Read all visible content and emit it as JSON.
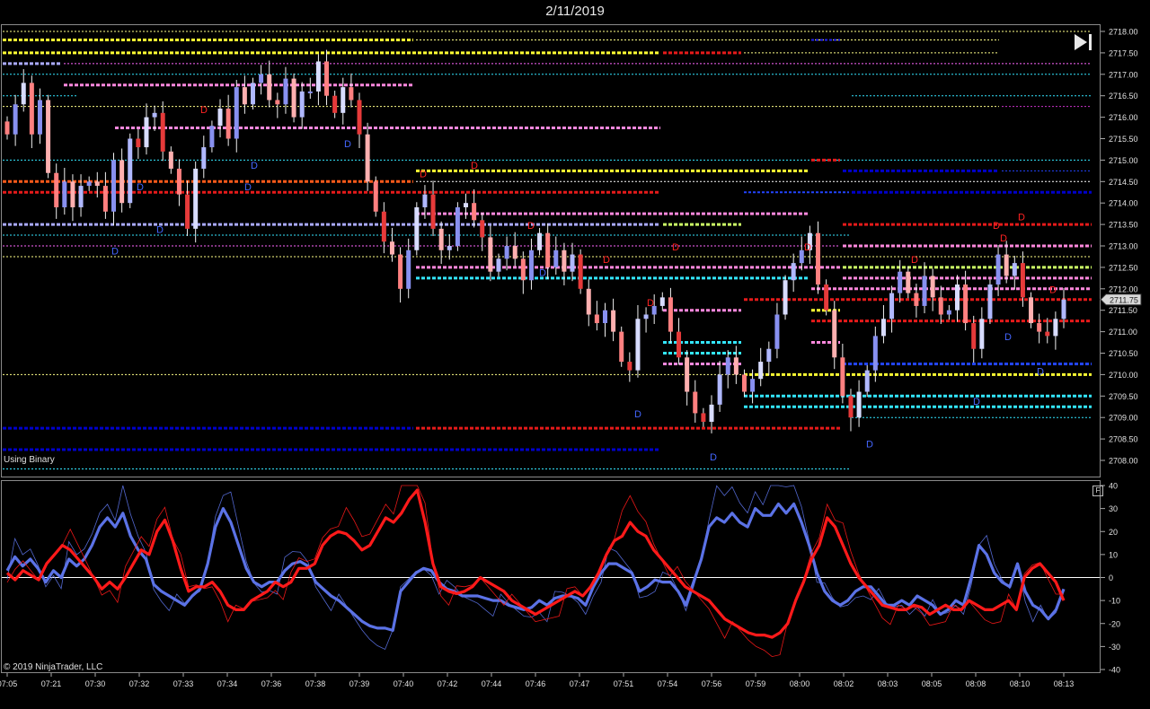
{
  "window": {
    "title": "2/11/2019"
  },
  "status_text": "Using Binary",
  "copyright": "© 2019 NinjaTrader, LLC",
  "buttons": {
    "skip_to_end": "skip-to-end-icon",
    "panel_f": "F"
  },
  "colors": {
    "up": "#b0b8ff",
    "down": "#ff8080",
    "blue_line": "#5b72e6",
    "red_line": "#ff1a1a",
    "yellow": "#ffff33",
    "pink": "#ff88dd",
    "cyan": "#33e6ff",
    "navy": "#0000cc",
    "red_level": "#e61a1a",
    "orange": "#ff5a1a"
  },
  "chart_data": [
    {
      "type": "candlestick",
      "title": "",
      "ylim": [
        2707.75,
        2718.1
      ],
      "y_ticks": [
        "2718.00",
        "2717.50",
        "2717.00",
        "2716.50",
        "2716.00",
        "2715.50",
        "2715.00",
        "2714.50",
        "2714.00",
        "2713.50",
        "2713.00",
        "2712.50",
        "2712.00",
        "2711.50",
        "2711.00",
        "2710.50",
        "2710.00",
        "2709.50",
        "2709.00",
        "2708.50",
        "2708.00"
      ],
      "current_price_label": "2711.75",
      "closes": [
        2715.6,
        2716.3,
        2716.8,
        2715.6,
        2716.4,
        2714.7,
        2713.9,
        2714.5,
        2713.9,
        2714.4,
        2714.5,
        2714.4,
        2713.8,
        2715.0,
        2714.0,
        2715.5,
        2715.3,
        2716.0,
        2716.1,
        2715.2,
        2714.8,
        2714.2,
        2713.4,
        2714.8,
        2715.3,
        2715.8,
        2716.2,
        2715.5,
        2716.7,
        2716.3,
        2716.8,
        2717.0,
        2716.4,
        2716.3,
        2716.9,
        2716.0,
        2716.6,
        2716.6,
        2717.3,
        2716.5,
        2716.1,
        2716.7,
        2716.4,
        2715.6,
        2714.5,
        2713.8,
        2713.1,
        2712.8,
        2712.0,
        2712.9,
        2713.9,
        2714.2,
        2713.4,
        2712.9,
        2713.0,
        2713.9,
        2714.0,
        2713.6,
        2713.2,
        2712.4,
        2712.7,
        2713.0,
        2712.7,
        2712.2,
        2712.9,
        2713.3,
        2712.5,
        2712.9,
        2712.4,
        2712.8,
        2712.0,
        2711.4,
        2711.2,
        2711.5,
        2711.0,
        2710.3,
        2710.1,
        2711.3,
        2711.4,
        2711.6,
        2711.8,
        2711.0,
        2710.4,
        2709.6,
        2709.1,
        2708.9,
        2709.3,
        2710.0,
        2710.4,
        2710.0,
        2709.6,
        2709.9,
        2710.3,
        2710.6,
        2711.4,
        2712.2,
        2712.6,
        2712.9,
        2713.3,
        2712.1,
        2711.5,
        2710.4,
        2709.5,
        2709.0,
        2709.6,
        2710.1,
        2710.9,
        2711.3,
        2711.9,
        2712.4,
        2711.9,
        2711.6,
        2712.3,
        2711.8,
        2711.4,
        2711.5,
        2712.1,
        2711.2,
        2710.6,
        2711.3,
        2712.1,
        2712.8,
        2712.3,
        2712.6,
        2711.8,
        2711.2,
        2711.0,
        2710.9,
        2711.3,
        2711.75
      ]
    },
    {
      "type": "line",
      "ylim": [
        -40,
        40
      ],
      "y_ticks": [
        "40",
        "30",
        "20",
        "10",
        "0",
        "-10",
        "-20",
        "-30",
        "-40"
      ],
      "series": [
        {
          "values": [
            3,
            9,
            5,
            8,
            4,
            -2,
            3,
            0,
            8,
            5,
            8,
            14,
            22,
            26,
            22,
            28,
            18,
            12,
            8,
            -3,
            -6,
            -8,
            -10,
            -12,
            -8,
            -5,
            6,
            22,
            30,
            24,
            14,
            4,
            -2,
            -4,
            -2,
            -2,
            3,
            6,
            7,
            5,
            -2,
            -5,
            -8,
            -10,
            -13,
            -16,
            -19,
            -21,
            -22,
            -22,
            -23,
            -6,
            -2,
            2,
            4,
            3,
            -2,
            -5,
            -6,
            -8,
            -8,
            -8,
            -9,
            -10,
            -10,
            -12,
            -13,
            -14,
            -13,
            -10,
            -12,
            -9,
            -8,
            -8,
            -9,
            -12,
            -4,
            2,
            6,
            6,
            4,
            2,
            -6,
            -4,
            -1,
            -2,
            -2,
            -6,
            -12,
            -2,
            8,
            22,
            26,
            24,
            28,
            24,
            22,
            30,
            27,
            27,
            32,
            28,
            32,
            24,
            14,
            2,
            -6,
            -10,
            -12,
            -10,
            -6,
            -4,
            -4,
            -8,
            -12,
            -12,
            -10,
            -12,
            -8,
            -10,
            -12,
            -16,
            -14,
            -10,
            -12,
            0,
            14,
            10,
            2,
            -2,
            -4,
            6,
            -6,
            -12,
            -14,
            -18,
            -14,
            -5
          ]
        },
        {
          "values": [
            2,
            -1,
            3,
            1,
            -1,
            6,
            10,
            14,
            12,
            8,
            4,
            0,
            -5,
            -2,
            -5,
            0,
            6,
            12,
            10,
            20,
            25,
            16,
            4,
            -6,
            -4,
            -4,
            -2,
            -6,
            -12,
            -14,
            -14,
            -10,
            -8,
            -6,
            -2,
            -4,
            -2,
            4,
            4,
            6,
            14,
            18,
            20,
            19,
            16,
            12,
            14,
            20,
            26,
            24,
            28,
            34,
            38,
            24,
            6,
            -4,
            -6,
            -7,
            -6,
            -4,
            0,
            -2,
            -4,
            -6,
            -10,
            -12,
            -14,
            -16,
            -14,
            -12,
            -10,
            -8,
            -6,
            -8,
            -4,
            2,
            10,
            16,
            18,
            24,
            20,
            18,
            12,
            8,
            4,
            0,
            -4,
            -6,
            -8,
            -10,
            -14,
            -18,
            -20,
            -22,
            -24,
            -25,
            -25,
            -26,
            -24,
            -20,
            -10,
            -2,
            8,
            14,
            26,
            22,
            14,
            6,
            0,
            -4,
            -8,
            -12,
            -13,
            -14,
            -14,
            -12,
            -13,
            -16,
            -14,
            -12,
            -14,
            -14,
            -10,
            -12,
            -14,
            -14,
            -12,
            -10,
            -14,
            0,
            4,
            6,
            2,
            -2,
            -10
          ]
        }
      ]
    }
  ],
  "x_ticks": [
    "07:05",
    "07:21",
    "07:30",
    "07:32",
    "07:33",
    "07:34",
    "07:36",
    "07:38",
    "07:39",
    "07:40",
    "07:42",
    "07:44",
    "07:46",
    "07:47",
    "07:51",
    "07:54",
    "07:56",
    "07:59",
    "08:00",
    "08:02",
    "08:03",
    "08:05",
    "08:08",
    "08:10",
    "08:13"
  ],
  "level_lines": [
    {
      "p": 2718.0,
      "x0": 0,
      "x1": 1215,
      "c": "#ffff88",
      "w": 1,
      "d": "2,2"
    },
    {
      "p": 2717.8,
      "x0": 0,
      "x1": 460,
      "c": "#ffff33",
      "w": 3,
      "d": "4,2"
    },
    {
      "p": 2717.8,
      "x0": 460,
      "x1": 1112,
      "c": "#ffff88",
      "w": 1,
      "d": "2,2"
    },
    {
      "p": 2717.5,
      "x0": 0,
      "x1": 735,
      "c": "#ffff33",
      "w": 3,
      "d": "4,2"
    },
    {
      "p": 2717.5,
      "x0": 735,
      "x1": 825,
      "c": "#e61a1a",
      "w": 3,
      "d": "4,2"
    },
    {
      "p": 2717.5,
      "x0": 825,
      "x1": 1112,
      "c": "#ffff88",
      "w": 1,
      "d": "2,2"
    },
    {
      "p": 2717.8,
      "x0": 900,
      "x1": 935,
      "c": "#2222ee",
      "w": 2,
      "d": "3,2"
    },
    {
      "p": 2717.25,
      "x0": 0,
      "x1": 68,
      "c": "#aaaaff",
      "w": 3,
      "d": "4,2"
    },
    {
      "p": 2717.25,
      "x0": 68,
      "x1": 1215,
      "c": "#ff66ff",
      "w": 1,
      "d": "2,2"
    },
    {
      "p": 2717.0,
      "x0": 0,
      "x1": 1215,
      "c": "#33e6ff",
      "w": 1,
      "d": "2,2"
    },
    {
      "p": 2716.75,
      "x0": 68,
      "x1": 460,
      "c": "#ff88dd",
      "w": 3,
      "d": "4,2"
    },
    {
      "p": 2716.5,
      "x0": 0,
      "x1": 85,
      "c": "#33e6ff",
      "w": 1,
      "d": "2,2"
    },
    {
      "p": 2716.5,
      "x0": 945,
      "x1": 1215,
      "c": "#33e6ff",
      "w": 1,
      "d": "2,2"
    },
    {
      "p": 2716.25,
      "x0": 0,
      "x1": 1112,
      "c": "#ffff88",
      "w": 1,
      "d": "2,2"
    },
    {
      "p": 2716.25,
      "x0": 1112,
      "x1": 1215,
      "c": "#cc33cc",
      "w": 1,
      "d": "2,2"
    },
    {
      "p": 2715.75,
      "x0": 125,
      "x1": 735,
      "c": "#ff88dd",
      "w": 3,
      "d": "4,2"
    },
    {
      "p": 2715.0,
      "x0": 0,
      "x1": 1215,
      "c": "#33e6ff",
      "w": 1,
      "d": "2,2"
    },
    {
      "p": 2715.0,
      "x0": 900,
      "x1": 935,
      "c": "#e61a1a",
      "w": 3,
      "d": "4,2"
    },
    {
      "p": 2714.75,
      "x0": 460,
      "x1": 900,
      "c": "#ffff33",
      "w": 3,
      "d": "4,2"
    },
    {
      "p": 2714.75,
      "x0": 935,
      "x1": 1112,
      "c": "#0000cc",
      "w": 3,
      "d": "4,2"
    },
    {
      "p": 2714.75,
      "x0": 1112,
      "x1": 1215,
      "c": "#2244ff",
      "w": 1,
      "d": "2,2"
    },
    {
      "p": 2714.5,
      "x0": 0,
      "x1": 460,
      "c": "#ff5a1a",
      "w": 3,
      "d": "4,2"
    },
    {
      "p": 2714.5,
      "x0": 460,
      "x1": 1215,
      "c": "#ffffff",
      "w": 1,
      "d": "2,2"
    },
    {
      "p": 2714.25,
      "x0": 0,
      "x1": 735,
      "c": "#e61a1a",
      "w": 3,
      "d": "4,2"
    },
    {
      "p": 2714.25,
      "x0": 825,
      "x1": 945,
      "c": "#2244ff",
      "w": 2,
      "d": "3,2"
    },
    {
      "p": 2714.25,
      "x0": 945,
      "x1": 1215,
      "c": "#0000cc",
      "w": 3,
      "d": "4,2"
    },
    {
      "p": 2713.75,
      "x0": 460,
      "x1": 900,
      "c": "#ff88dd",
      "w": 3,
      "d": "4,2"
    },
    {
      "p": 2713.5,
      "x0": 0,
      "x1": 735,
      "c": "#aaaaff",
      "w": 3,
      "d": "4,2"
    },
    {
      "p": 2713.5,
      "x0": 735,
      "x1": 825,
      "c": "#ccff66",
      "w": 3,
      "d": "4,2"
    },
    {
      "p": 2713.5,
      "x0": 935,
      "x1": 1215,
      "c": "#e61a1a",
      "w": 3,
      "d": "4,2"
    },
    {
      "p": 2713.25,
      "x0": 0,
      "x1": 945,
      "c": "#33e6ff",
      "w": 1,
      "d": "2,2"
    },
    {
      "p": 2713.0,
      "x0": 0,
      "x1": 935,
      "c": "#ff66ff",
      "w": 1,
      "d": "2,2"
    },
    {
      "p": 2713.0,
      "x0": 935,
      "x1": 1215,
      "c": "#ff88dd",
      "w": 3,
      "d": "4,2"
    },
    {
      "p": 2712.75,
      "x0": 0,
      "x1": 1215,
      "c": "#ffff88",
      "w": 1,
      "d": "2,2"
    },
    {
      "p": 2712.5,
      "x0": 460,
      "x1": 935,
      "c": "#ff88dd",
      "w": 3,
      "d": "4,2"
    },
    {
      "p": 2712.5,
      "x0": 935,
      "x1": 1215,
      "c": "#ccff66",
      "w": 3,
      "d": "4,2"
    },
    {
      "p": 2712.25,
      "x0": 460,
      "x1": 900,
      "c": "#33e6ff",
      "w": 3,
      "d": "4,2"
    },
    {
      "p": 2712.25,
      "x0": 935,
      "x1": 1215,
      "c": "#ff88dd",
      "w": 3,
      "d": "4,2"
    },
    {
      "p": 2712.0,
      "x0": 900,
      "x1": 1215,
      "c": "#ff88dd",
      "w": 3,
      "d": "4,2"
    },
    {
      "p": 2711.75,
      "x0": 825,
      "x1": 1215,
      "c": "#e61a1a",
      "w": 3,
      "d": "4,2"
    },
    {
      "p": 2711.5,
      "x0": 735,
      "x1": 825,
      "c": "#ff88dd",
      "w": 3,
      "d": "4,2"
    },
    {
      "p": 2711.5,
      "x0": 900,
      "x1": 935,
      "c": "#ffff33",
      "w": 3,
      "d": "4,2"
    },
    {
      "p": 2711.25,
      "x0": 900,
      "x1": 1215,
      "c": "#e61a1a",
      "w": 3,
      "d": "4,2"
    },
    {
      "p": 2710.75,
      "x0": 735,
      "x1": 825,
      "c": "#33e6ff",
      "w": 3,
      "d": "4,2"
    },
    {
      "p": 2710.75,
      "x0": 900,
      "x1": 935,
      "c": "#ff88dd",
      "w": 3,
      "d": "4,2"
    },
    {
      "p": 2710.5,
      "x0": 735,
      "x1": 825,
      "c": "#33e6ff",
      "w": 3,
      "d": "4,2"
    },
    {
      "p": 2710.25,
      "x0": 735,
      "x1": 825,
      "c": "#ff88dd",
      "w": 3,
      "d": "4,2"
    },
    {
      "p": 2710.25,
      "x0": 935,
      "x1": 1215,
      "c": "#2244ff",
      "w": 3,
      "d": "4,2"
    },
    {
      "p": 2710.0,
      "x0": 0,
      "x1": 825,
      "c": "#ffff88",
      "w": 1,
      "d": "2,2"
    },
    {
      "p": 2710.0,
      "x0": 825,
      "x1": 1215,
      "c": "#ffff33",
      "w": 3,
      "d": "4,2"
    },
    {
      "p": 2709.5,
      "x0": 825,
      "x1": 1215,
      "c": "#33e6ff",
      "w": 3,
      "d": "4,2"
    },
    {
      "p": 2709.25,
      "x0": 825,
      "x1": 1215,
      "c": "#33e6ff",
      "w": 3,
      "d": "4,2"
    },
    {
      "p": 2709.0,
      "x0": 945,
      "x1": 1215,
      "c": "#33e6ff",
      "w": 1,
      "d": "2,2"
    },
    {
      "p": 2708.75,
      "x0": 0,
      "x1": 460,
      "c": "#0000cc",
      "w": 3,
      "d": "4,2"
    },
    {
      "p": 2708.75,
      "x0": 460,
      "x1": 935,
      "c": "#e61a1a",
      "w": 3,
      "d": "4,2"
    },
    {
      "p": 2708.25,
      "x0": 0,
      "x1": 735,
      "c": "#0000cc",
      "w": 3,
      "d": "4,2"
    },
    {
      "p": 2707.8,
      "x0": 0,
      "x1": 945,
      "c": "#33e6ff",
      "w": 1,
      "d": "2,2"
    }
  ],
  "markers": [
    {
      "t": "D",
      "x": 227,
      "p": 2716.1,
      "c": "#ff2222"
    },
    {
      "t": "D",
      "x": 156,
      "p": 2714.3,
      "c": "#4466ff"
    },
    {
      "t": "D",
      "x": 283,
      "p": 2714.8,
      "c": "#4466ff"
    },
    {
      "t": "D",
      "x": 276,
      "p": 2714.3,
      "c": "#4466ff"
    },
    {
      "t": "D",
      "x": 387,
      "p": 2715.3,
      "c": "#4466ff"
    },
    {
      "t": "D",
      "x": 178,
      "p": 2713.3,
      "c": "#4466ff"
    },
    {
      "t": "D",
      "x": 128,
      "p": 2712.8,
      "c": "#4466ff"
    },
    {
      "t": "D",
      "x": 471,
      "p": 2714.6,
      "c": "#ff2222"
    },
    {
      "t": "D",
      "x": 528,
      "p": 2714.8,
      "c": "#ff2222"
    },
    {
      "t": "D",
      "x": 591,
      "p": 2713.4,
      "c": "#ff2222"
    },
    {
      "t": "D",
      "x": 604,
      "p": 2712.3,
      "c": "#4466ff"
    },
    {
      "t": "D",
      "x": 675,
      "p": 2712.6,
      "c": "#ff2222"
    },
    {
      "t": "D",
      "x": 724,
      "p": 2711.6,
      "c": "#ff2222"
    },
    {
      "t": "D",
      "x": 752,
      "p": 2712.9,
      "c": "#ff2222"
    },
    {
      "t": "D",
      "x": 710,
      "p": 2709.0,
      "c": "#4466ff"
    },
    {
      "t": "D",
      "x": 794,
      "p": 2708.0,
      "c": "#4466ff"
    },
    {
      "t": "D",
      "x": 899,
      "p": 2712.9,
      "c": "#ff2222"
    },
    {
      "t": "D",
      "x": 968,
      "p": 2708.3,
      "c": "#4466ff"
    },
    {
      "t": "D",
      "x": 1018,
      "p": 2712.6,
      "c": "#ff2222"
    },
    {
      "t": "D",
      "x": 1087,
      "p": 2709.3,
      "c": "#4466ff"
    },
    {
      "t": "D",
      "x": 1109,
      "p": 2713.4,
      "c": "#ff2222"
    },
    {
      "t": "D",
      "x": 1117,
      "p": 2713.1,
      "c": "#ff2222"
    },
    {
      "t": "D",
      "x": 1137,
      "p": 2713.6,
      "c": "#ff2222"
    },
    {
      "t": "D",
      "x": 1122,
      "p": 2710.8,
      "c": "#4466ff"
    },
    {
      "t": "D",
      "x": 1158,
      "p": 2710.0,
      "c": "#4466ff"
    },
    {
      "t": "D",
      "x": 1172,
      "p": 2711.9,
      "c": "#ff2222"
    }
  ]
}
